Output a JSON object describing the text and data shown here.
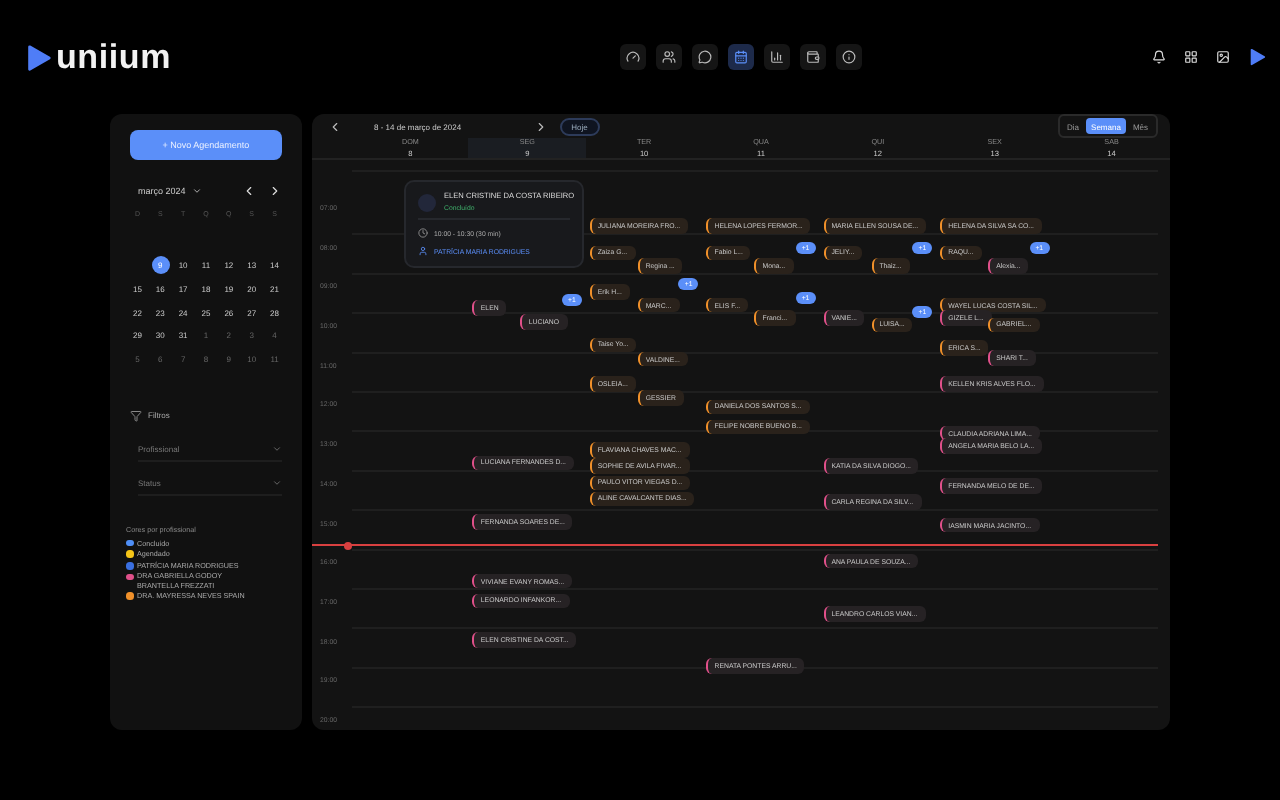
{
  "brand": {
    "name": "uniium"
  },
  "nav": [
    {
      "kind": "gauge",
      "selected": false
    },
    {
      "kind": "users",
      "selected": false
    },
    {
      "kind": "chat",
      "selected": false
    },
    {
      "kind": "calendar",
      "selected": true
    },
    {
      "kind": "chart",
      "selected": false
    },
    {
      "kind": "wallet",
      "selected": false
    },
    {
      "kind": "info",
      "selected": false
    }
  ],
  "sidebar": {
    "new_button": "+ Novo Agendamento",
    "month": "março 2024",
    "weekdays": [
      "D",
      "S",
      "T",
      "Q",
      "Q",
      "S",
      "S"
    ],
    "weeks": [
      [
        {
          "label": "9",
          "selected": true,
          "muted": false
        },
        {
          "label": "10",
          "selected": false,
          "muted": false
        },
        {
          "label": "11",
          "selected": false,
          "muted": false
        },
        {
          "label": "12",
          "selected": false,
          "muted": false
        },
        {
          "label": "13",
          "selected": false,
          "muted": false
        },
        {
          "label": "14",
          "selected": false,
          "muted": false
        }
      ],
      [
        {
          "label": "15",
          "selected": false,
          "muted": false
        },
        {
          "label": "16",
          "selected": false,
          "muted": false
        },
        {
          "label": "17",
          "selected": false,
          "muted": false
        },
        {
          "label": "18",
          "selected": false,
          "muted": false
        },
        {
          "label": "19",
          "selected": false,
          "muted": false
        },
        {
          "label": "20",
          "selected": false,
          "muted": false
        },
        {
          "label": "21",
          "selected": false,
          "muted": false
        }
      ],
      [
        {
          "label": "22",
          "selected": false,
          "muted": false
        },
        {
          "label": "23",
          "selected": false,
          "muted": false
        },
        {
          "label": "24",
          "selected": false,
          "muted": false
        },
        {
          "label": "25",
          "selected": false,
          "muted": false
        },
        {
          "label": "26",
          "selected": false,
          "muted": false
        },
        {
          "label": "27",
          "selected": false,
          "muted": false
        },
        {
          "label": "28",
          "selected": false,
          "muted": false
        }
      ],
      [
        {
          "label": "29",
          "selected": false,
          "muted": false
        },
        {
          "label": "30",
          "selected": false,
          "muted": false
        },
        {
          "label": "31",
          "selected": false,
          "muted": false
        },
        {
          "label": "1",
          "selected": false,
          "muted": true
        },
        {
          "label": "2",
          "selected": false,
          "muted": true
        },
        {
          "label": "3",
          "selected": false,
          "muted": true
        },
        {
          "label": "4",
          "selected": false,
          "muted": true
        }
      ],
      [
        {
          "label": "5",
          "selected": false,
          "muted": true
        },
        {
          "label": "6",
          "selected": false,
          "muted": true
        },
        {
          "label": "7",
          "selected": false,
          "muted": true
        },
        {
          "label": "8",
          "selected": false,
          "muted": true
        },
        {
          "label": "9",
          "selected": false,
          "muted": true
        },
        {
          "label": "10",
          "selected": false,
          "muted": true
        },
        {
          "label": "11",
          "selected": false,
          "muted": true
        }
      ]
    ],
    "filters_title": "Filtros",
    "filters": [
      "Profissional",
      "Status"
    ],
    "legend_title": "Cores por profissional",
    "legend": [
      {
        "label": "Concluído",
        "color": "#4f8ff7"
      },
      {
        "label": "Agendado",
        "color": "#f5c518"
      },
      {
        "label": "PATRÍCIA MARIA RODRIGUES",
        "color": "#3a6fe0"
      },
      {
        "label": "DRA GABRIELLA GODOY BRANTELLA FREZZATI",
        "color": "#e0508a"
      },
      {
        "label": "DRA. MAYRESSA NEVES SPAIN",
        "color": "#f0902a"
      }
    ]
  },
  "toolbar": {
    "range": "8 - 14 de março de 2024",
    "today": "Hoje",
    "views": [
      {
        "label": "Dia",
        "selected": false
      },
      {
        "label": "Semana",
        "selected": true
      },
      {
        "label": "Mês",
        "selected": false
      }
    ]
  },
  "hours": [
    "07:00",
    "08:00",
    "09:00",
    "10:00",
    "11:00",
    "12:00",
    "13:00",
    "14:00",
    "15:00",
    "16:00",
    "17:00",
    "18:00",
    "19:00",
    "20:00"
  ],
  "days": [
    {
      "weekday": "DOM",
      "date": "8",
      "selected": false
    },
    {
      "weekday": "SEG",
      "date": "9",
      "selected": true,
      "events": [
        {
          "kind": "appointment",
          "name": "ELEN",
          "color": "#e0508a"
        },
        {
          "kind": "appointment",
          "name": "LUCIANO",
          "color": "#e0508a"
        },
        {
          "kind": "more",
          "label": "+1"
        },
        {
          "kind": "appointment",
          "name": "LUCIANA FERNANDES D...",
          "color": "#e0508a"
        },
        {
          "kind": "appointment",
          "name": "FERNANDA SOARES DE...",
          "color": "#e0508a"
        },
        {
          "kind": "appointment",
          "name": "VIVIANE EVANY ROMAS...",
          "color": "#e0508a"
        },
        {
          "kind": "appointment",
          "name": "LEONARDO INFANKOR...",
          "color": "#e0508a"
        },
        {
          "kind": "appointment",
          "name": "ELEN CRISTINE DA COST...",
          "color": "#e0508a"
        }
      ]
    },
    {
      "weekday": "TER",
      "date": "10",
      "selected": false,
      "events": [
        {
          "kind": "appointment",
          "name": "JULIANA MOREIRA FRO...",
          "color": "#f0902a"
        },
        {
          "kind": "appointment",
          "name": "Zaiza G...",
          "color": "#f0902a"
        },
        {
          "kind": "appointment",
          "name": "Regina ...",
          "color": "#f0902a"
        },
        {
          "kind": "appointment",
          "name": "Erik H...",
          "color": "#f0902a"
        },
        {
          "kind": "more",
          "label": "+1"
        },
        {
          "kind": "appointment",
          "name": "MARC...",
          "color": "#f0902a"
        },
        {
          "kind": "appointment",
          "name": "Taise Yo...",
          "color": "#f0902a"
        },
        {
          "kind": "appointment",
          "name": "VALDINE...",
          "color": "#f0902a"
        },
        {
          "kind": "appointment",
          "name": "OSLEIA...",
          "color": "#f0902a"
        },
        {
          "kind": "appointment",
          "name": "GESSIER",
          "color": "#f0902a"
        },
        {
          "kind": "appointment",
          "name": "FLAVIANA CHAVES MAC...",
          "color": "#f0902a"
        },
        {
          "kind": "appointment",
          "name": "SOPHIE DE AVILA FIVAR...",
          "color": "#f0902a"
        },
        {
          "kind": "appointment",
          "name": "PAULO VITOR VIEGAS D...",
          "color": "#f0902a"
        },
        {
          "kind": "appointment",
          "name": "ALINE CAVALCANTE DIAS...",
          "color": "#f0902a"
        }
      ]
    },
    {
      "weekday": "QUA",
      "date": "11",
      "selected": false,
      "events": [
        {
          "kind": "appointment",
          "name": "HELENA LOPES FERMOR...",
          "color": "#f0902a"
        },
        {
          "kind": "appointment",
          "name": "Fabio L...",
          "color": "#f0902a"
        },
        {
          "kind": "appointment",
          "name": "Mona...",
          "color": "#f0902a"
        },
        {
          "kind": "more",
          "label": "+1"
        },
        {
          "kind": "appointment",
          "name": "ELIS F...",
          "color": "#f0902a"
        },
        {
          "kind": "more",
          "label": "+1"
        },
        {
          "kind": "appointment",
          "name": "Franci...",
          "color": "#f0902a"
        },
        {
          "kind": "appointment",
          "name": "DANIELA DOS SANTOS S...",
          "color": "#f0902a"
        },
        {
          "kind": "appointment",
          "name": "FELIPE NOBRE BUENO B...",
          "color": "#f0902a"
        },
        {
          "kind": "appointment",
          "name": "RENATA PONTES ARRU...",
          "color": "#e0508a"
        }
      ]
    },
    {
      "weekday": "QUI",
      "date": "12",
      "selected": false,
      "events": [
        {
          "kind": "appointment",
          "name": "MARIA ELLEN SOUSA DE...",
          "color": "#f0902a"
        },
        {
          "kind": "appointment",
          "name": "JELIY...",
          "color": "#f0902a"
        },
        {
          "kind": "more",
          "label": "+1"
        },
        {
          "kind": "appointment",
          "name": "Thaiz...",
          "color": "#f0902a"
        },
        {
          "kind": "appointment",
          "name": "VANIE...",
          "color": "#e0508a"
        },
        {
          "kind": "more",
          "label": "+1"
        },
        {
          "kind": "appointment",
          "name": "LUISA...",
          "color": "#f0902a"
        },
        {
          "kind": "appointment",
          "name": "KATIA DA SILVA DIOGO...",
          "color": "#e0508a"
        },
        {
          "kind": "appointment",
          "name": "CARLA REGINA DA SILV...",
          "color": "#e0508a"
        },
        {
          "kind": "appointment",
          "name": "ANA PAULA DE SOUZA...",
          "color": "#e0508a"
        },
        {
          "kind": "appointment",
          "name": "LEANDRO CARLOS VIAN...",
          "color": "#e0508a"
        }
      ]
    },
    {
      "weekday": "SEX",
      "date": "13",
      "selected": false,
      "events": [
        {
          "kind": "appointment",
          "name": "HELENA DA SILVA SA CO...",
          "color": "#f0902a"
        },
        {
          "kind": "appointment",
          "name": "RAQU...",
          "color": "#f0902a"
        },
        {
          "kind": "more",
          "label": "+1"
        },
        {
          "kind": "appointment",
          "name": "Alexia...",
          "color": "#e0508a"
        },
        {
          "kind": "appointment",
          "name": "WAYEL LUCAS COSTA SIL...",
          "color": "#f0902a"
        },
        {
          "kind": "appointment",
          "name": "GIZELE L...",
          "color": "#e0508a"
        },
        {
          "kind": "appointment",
          "name": "GABRIEL...",
          "color": "#f0902a"
        },
        {
          "kind": "appointment",
          "name": "ERICA S...",
          "color": "#f0902a"
        },
        {
          "kind": "appointment",
          "name": "SHARI T...",
          "color": "#e0508a"
        },
        {
          "kind": "appointment",
          "name": "KELLEN KRIS ALVES FLO...",
          "color": "#e0508a"
        },
        {
          "kind": "appointment",
          "name": "CLAUDIA ADRIANA LIMA...",
          "color": "#e0508a"
        },
        {
          "kind": "appointment",
          "name": "ANGELA MARIA BELO LA...",
          "color": "#e0508a"
        },
        {
          "kind": "appointment",
          "name": "FERNANDA MELO DE DE...",
          "color": "#e0508a"
        },
        {
          "kind": "appointment",
          "name": "IASMIN MARIA JACINTO...",
          "color": "#e0508a"
        }
      ]
    },
    {
      "weekday": "SAB",
      "date": "14",
      "selected": false
    }
  ],
  "popover": {
    "name": "ELEN CRISTINE DA COSTA RIBEIRO",
    "status": "Concluído",
    "time": "10:00 - 10:30 (30 min)",
    "professional": "PATRÍCIA MARIA RODRIGUES"
  }
}
